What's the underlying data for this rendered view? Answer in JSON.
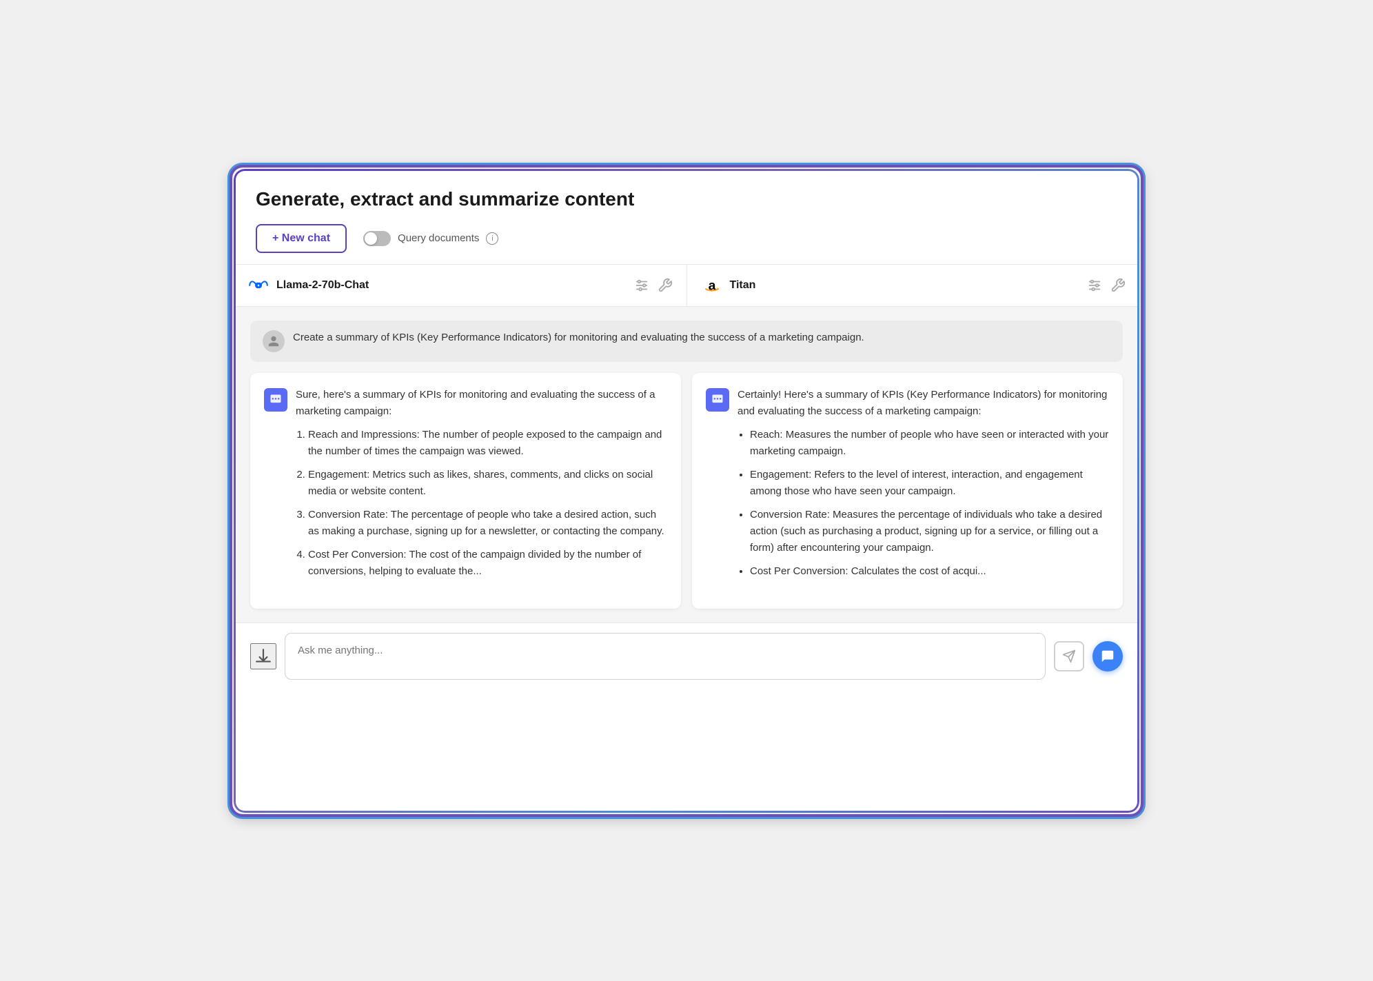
{
  "page": {
    "title": "Generate, extract and summarize content"
  },
  "toolbar": {
    "new_chat_label": "+ New chat",
    "query_docs_label": "Query documents",
    "info_label": "ⓘ"
  },
  "models": [
    {
      "id": "llama",
      "name": "Llama-2-70b-Chat",
      "logo": "meta"
    },
    {
      "id": "titan",
      "name": "Titan",
      "logo": "amazon"
    }
  ],
  "user_message": "Create a summary of KPIs (Key Performance Indicators) for monitoring and evaluating the success of a marketing campaign.",
  "responses": [
    {
      "id": "llama_response",
      "intro": "Sure, here's a summary of KPIs for monitoring and evaluating the success of a marketing campaign:",
      "items": [
        "Reach and Impressions: The number of people exposed to the campaign and the number of times the campaign was viewed.",
        "Engagement: Metrics such as likes, shares, comments, and clicks on social media or website content.",
        "Conversion Rate: The percentage of people who take a desired action, such as making a purchase, signing up for a newsletter, or contacting the company.",
        "Cost Per Conversion: The cost of the campaign divided by the number of conversions, helping to evaluate the..."
      ],
      "list_type": "ordered"
    },
    {
      "id": "titan_response",
      "intro": "Certainly! Here's a summary of KPIs (Key Performance Indicators) for monitoring and evaluating the success of a marketing campaign:",
      "items": [
        "Reach: Measures the number of people who have seen or interacted with your marketing campaign.",
        "Engagement: Refers to the level of interest, interaction, and engagement among those who have seen your campaign.",
        "Conversion Rate: Measures the percentage of individuals who take a desired action (such as purchasing a product, signing up for a service, or filling out a form) after encountering your campaign.",
        "Cost Per Conversion: Calculates the cost of acqui..."
      ],
      "list_type": "unordered"
    }
  ],
  "input": {
    "placeholder": "Ask me anything..."
  }
}
